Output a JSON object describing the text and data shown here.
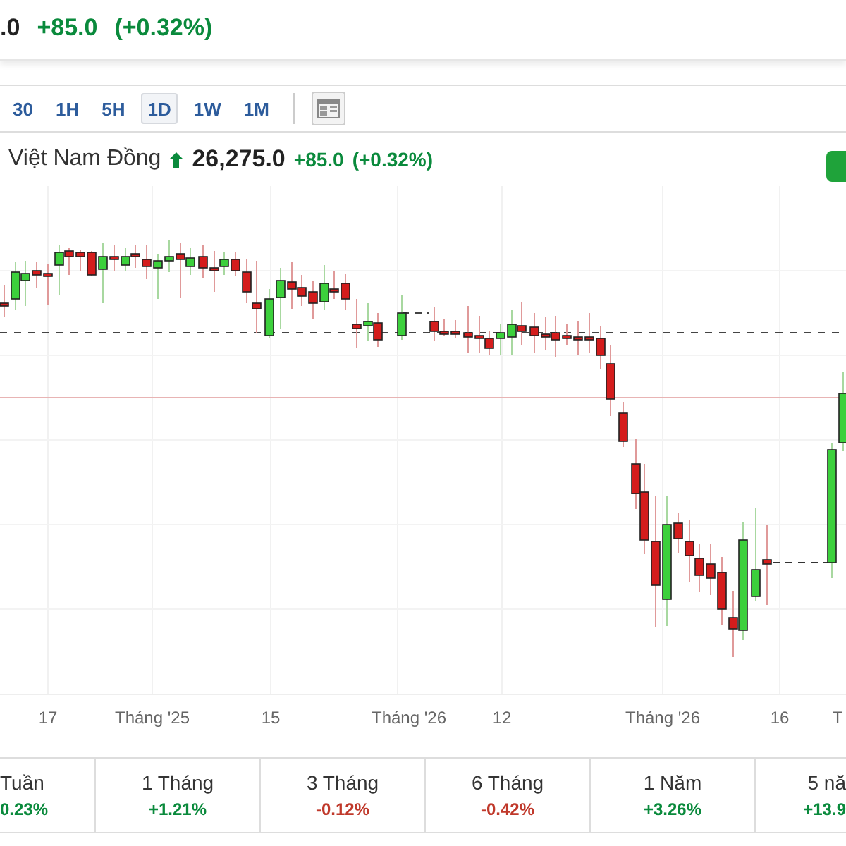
{
  "header": {
    "price": ".0",
    "change": "+85.0",
    "percent": "(+0.32%)"
  },
  "intervals": [
    {
      "label": "30",
      "selected": false
    },
    {
      "label": "1H",
      "selected": false
    },
    {
      "label": "5H",
      "selected": false
    },
    {
      "label": "1D",
      "selected": true
    },
    {
      "label": "1W",
      "selected": false
    },
    {
      "label": "1M",
      "selected": false
    }
  ],
  "quote": {
    "name": "Việt Nam Đồng",
    "price": "26,275.0",
    "change": "+85.0",
    "percent": "(+0.32%)"
  },
  "x_axis": [
    "17",
    "Tháng '25",
    "15",
    "Tháng '26",
    "12",
    "Tháng '26",
    "16",
    "T"
  ],
  "performance": [
    {
      "period": "Tuần",
      "change": "0.23%",
      "color": "#0a8a3c"
    },
    {
      "period": "1 Tháng",
      "change": "+1.21%",
      "color": "#0a8a3c"
    },
    {
      "period": "3 Tháng",
      "change": "-0.12%",
      "color": "#c0392b"
    },
    {
      "period": "6 Tháng",
      "change": "-0.42%",
      "color": "#c0392b"
    },
    {
      "period": "1 Năm",
      "change": "+3.26%",
      "color": "#0a8a3c"
    },
    {
      "period": "5 nă",
      "change": "+13.9",
      "color": "#0a8a3c"
    }
  ]
}
